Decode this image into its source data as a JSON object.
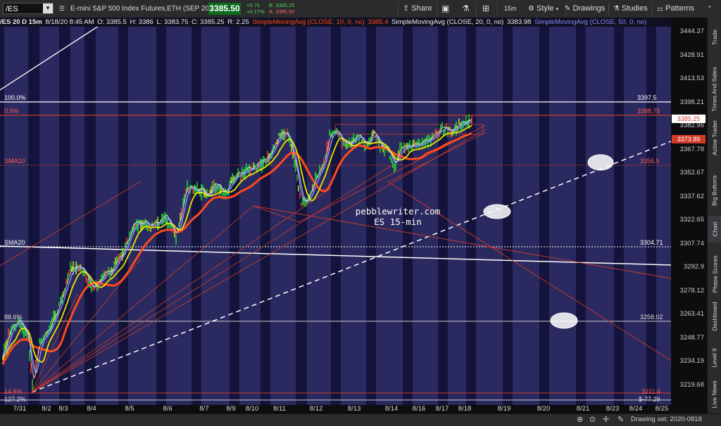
{
  "topbar": {
    "symbol": "/ES",
    "description": "E-mini S&P 500 Index Futures,ETH (SEP 20)",
    "last_price": "3385.50",
    "change": "+5.75",
    "change_pct": "+0.17%",
    "bid": "B: 3385.25",
    "ask": "A: 3385.50",
    "share_label": "Share",
    "timeframe": "15m",
    "style_label": "Style",
    "drawings_label": "Drawings",
    "studies_label": "Studies",
    "patterns_label": "Patterns"
  },
  "chart_header": {
    "symbol_info": "/ES 20 D 15m",
    "date": "8/18/20 8:45 AM",
    "open": "O: 3385.5",
    "high": "H: 3386",
    "low": "L: 3383.75",
    "close": "C: 3385.25",
    "range": "R: 2.25",
    "sma10_label": "SimpleMovingAvg (CLOSE, 10, 0, no)",
    "sma10_value": "3385.4",
    "sma20_label": "SimpleMovingAvg (CLOSE, 20, 0, no)",
    "sma20_value": "3383.98",
    "sma50_label": "SimpleMovingAvg (CLOSE, 50, 0, no)"
  },
  "colors": {
    "plot_bg": "#1e1e58",
    "band_dark": "#13133b",
    "band_light": "#2a2a60",
    "price_green": "#0c6b1e",
    "sma10": "#e8e800",
    "sma20": "#ff4a1c",
    "sma50": "#8888ff",
    "fib_red": "#d43a2a",
    "white_line": "#ffffff"
  },
  "y_ticks": [
    "3444.37",
    "3428.91",
    "3413.53",
    "3398.21",
    "3382.96",
    "3367.78",
    "3352.67",
    "3337.62",
    "3322.65",
    "3307.74",
    "3292.9",
    "3278.12",
    "3263.41",
    "3248.77",
    "3234.19",
    "3219.68"
  ],
  "price_labels": {
    "current": "3385.25",
    "sma": "3373.89",
    "fib100": "3397.5",
    "fib0": "3388.75",
    "sma10": "3356.5",
    "sma20": "3304.71",
    "fib886": "3258.02",
    "fib146": "3211.4",
    "fib1272": "$-77.29"
  },
  "chart_labels": {
    "fib100": "100.0%",
    "fib0": "0.0%",
    "sma10": "SMA10",
    "sma20": "SMA20",
    "fib886": "88.6%",
    "fib146": "14.6%",
    "fib1272": "127.2%"
  },
  "watermark": {
    "line1": "pebblewriter.com",
    "line2": "ES 15-min"
  },
  "x_ticks": [
    "7/31",
    "8/2",
    "8/3",
    "8/4",
    "8/5",
    "8/6",
    "8/7",
    "8/9",
    "8/10",
    "8/11",
    "8/12",
    "8/13",
    "8/14",
    "8/16",
    "8/17",
    "8/18",
    "8/19",
    "8/20",
    "8/21",
    "8/23",
    "8/24",
    "8/25"
  ],
  "right_tabs": [
    "Trade",
    "Times And Sales",
    "Active Trader",
    "Big Buttons",
    "Chart",
    "Phase Scores",
    "Dashboard",
    "Level II",
    "Live News"
  ],
  "bottombar": {
    "drawing_set": "Drawing set: 2020-0818"
  }
}
